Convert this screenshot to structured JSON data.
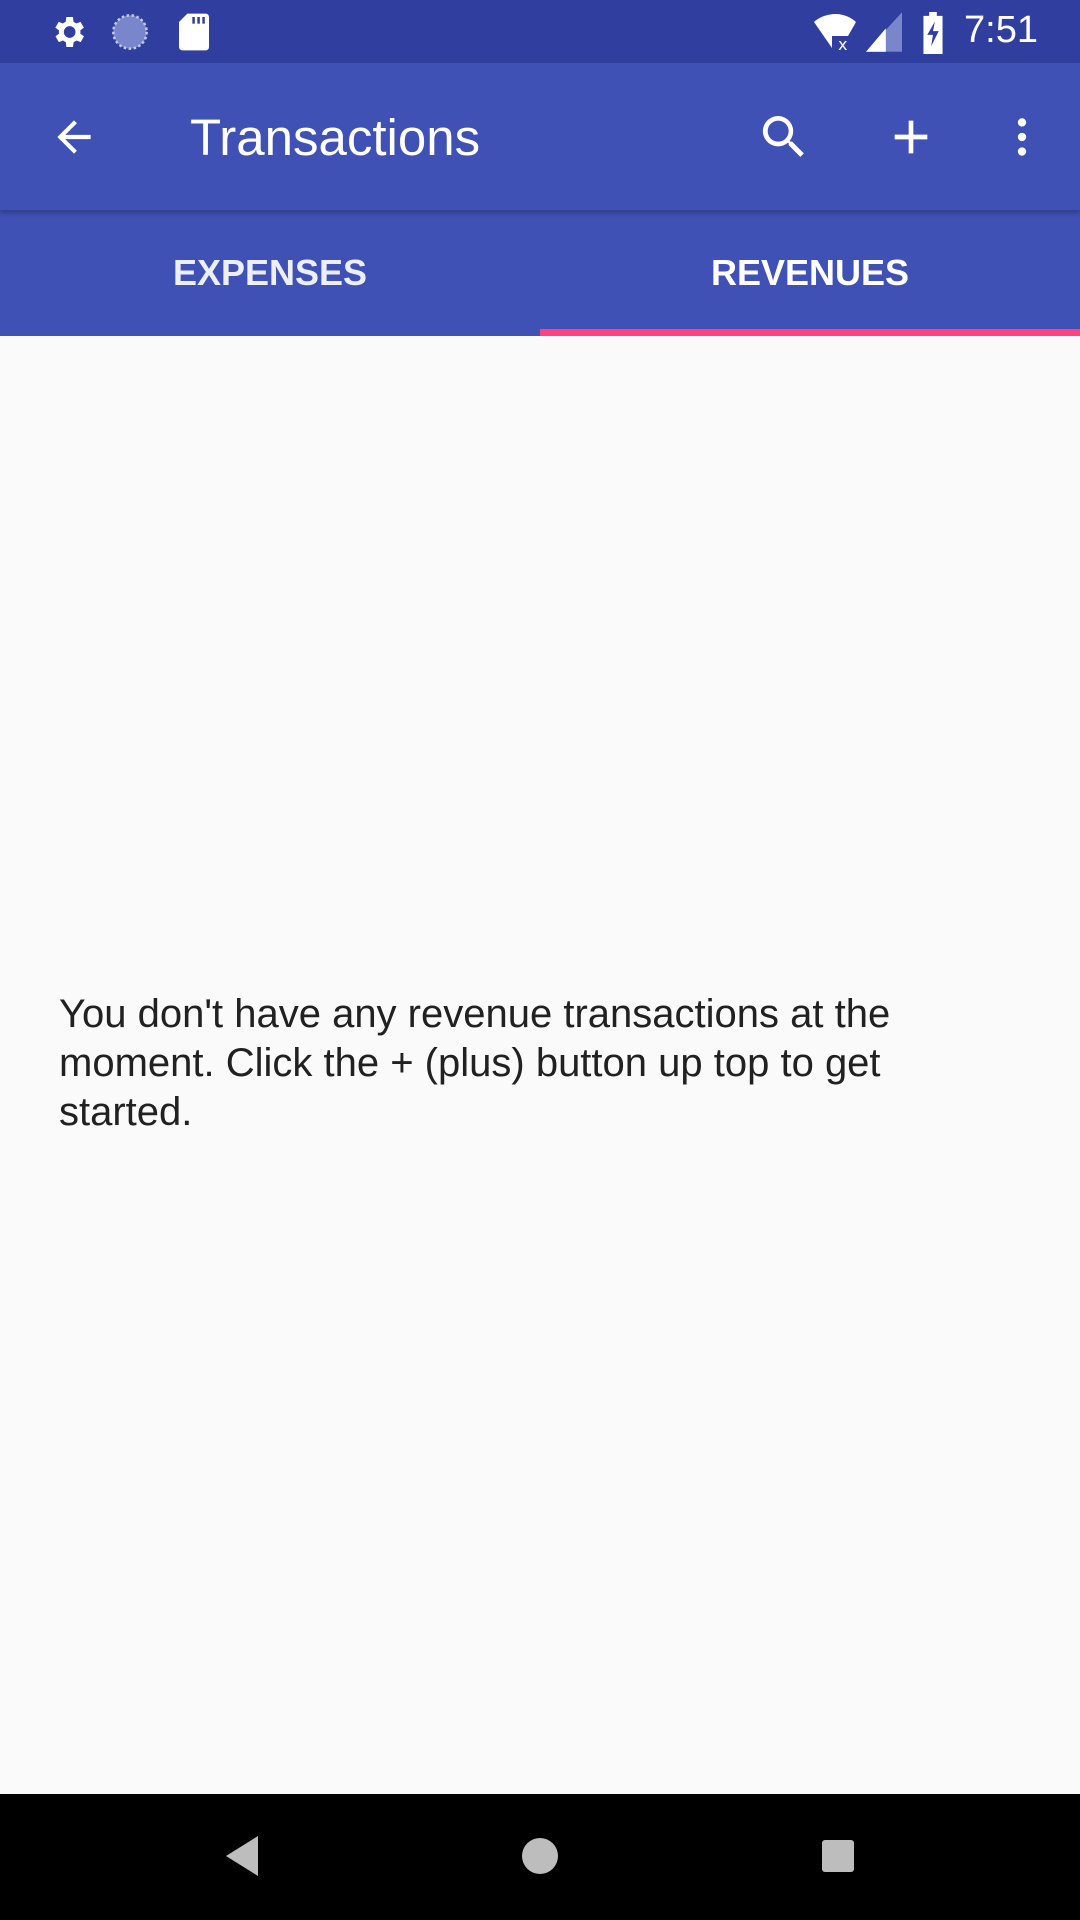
{
  "status_bar": {
    "time": "7:51",
    "icons": [
      "settings-icon",
      "sync-icon",
      "sd-card-icon",
      "wifi-off-icon",
      "signal-icon",
      "battery-charging-icon"
    ]
  },
  "toolbar": {
    "title": "Transactions",
    "icons": [
      "back-arrow-icon",
      "search-icon",
      "add-icon",
      "more-vert-icon"
    ]
  },
  "tabs": [
    {
      "label": "EXPENSES",
      "active": false
    },
    {
      "label": "REVENUES",
      "active": true
    }
  ],
  "content": {
    "empty_message": "You don't have any revenue transactions at the moment. Click the + (plus) button up top to get started."
  },
  "colors": {
    "primary": "#3f51b5",
    "primary_dark": "#303f9f",
    "accent": "#ff4081"
  }
}
